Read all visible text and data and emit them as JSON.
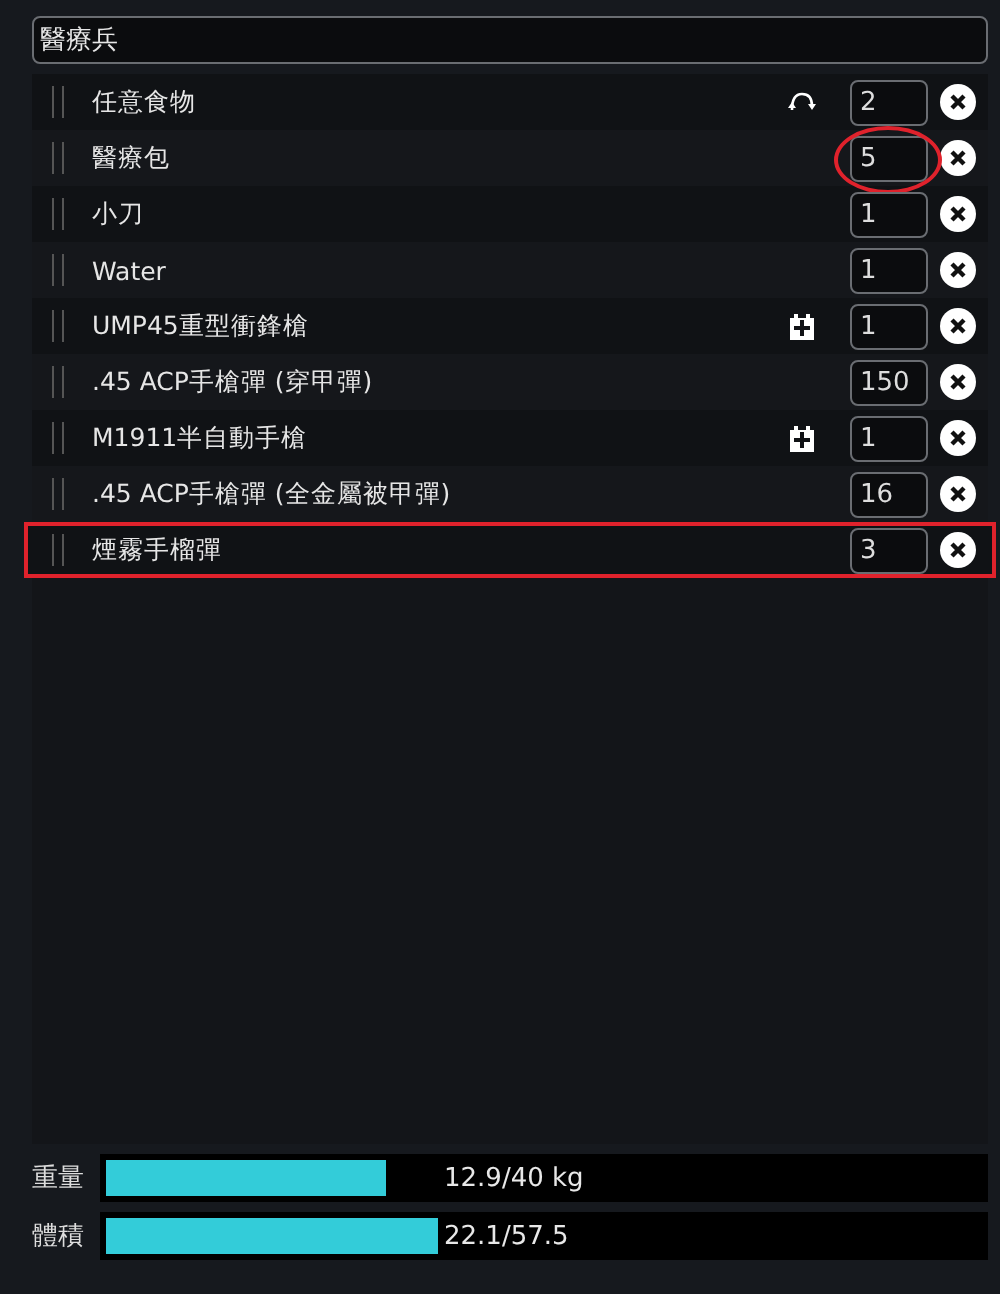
{
  "loadout_name": "醫療兵",
  "items": [
    {
      "name": "任意食物",
      "kind": "swap",
      "quantity": "2",
      "circled": false,
      "highlighted": false
    },
    {
      "name": "醫療包",
      "kind": "plain",
      "quantity": "5",
      "circled": true,
      "highlighted": false
    },
    {
      "name": "小刀",
      "kind": "plain",
      "quantity": "1",
      "circled": false,
      "highlighted": false
    },
    {
      "name": "Water",
      "kind": "plain",
      "quantity": "1",
      "circled": false,
      "highlighted": false
    },
    {
      "name": "UMP45重型衝鋒槍",
      "kind": "weapon",
      "quantity": "1",
      "circled": false,
      "highlighted": false
    },
    {
      "name": ".45 ACP手槍彈 (穿甲彈)",
      "kind": "plain",
      "quantity": "150",
      "circled": false,
      "highlighted": false
    },
    {
      "name": "M1911半自動手槍",
      "kind": "weapon",
      "quantity": "1",
      "circled": false,
      "highlighted": false
    },
    {
      "name": ".45 ACP手槍彈 (全金屬被甲彈)",
      "kind": "plain",
      "quantity": "16",
      "circled": false,
      "highlighted": false
    },
    {
      "name": "煙霧手榴彈",
      "kind": "plain",
      "quantity": "3",
      "circled": false,
      "highlighted": true
    }
  ],
  "meters": [
    {
      "label": "重量",
      "level": 0.32,
      "reading": "12.9/40 kg"
    },
    {
      "label": "體積",
      "level": 0.38,
      "reading": "22.1/57.5"
    }
  ]
}
